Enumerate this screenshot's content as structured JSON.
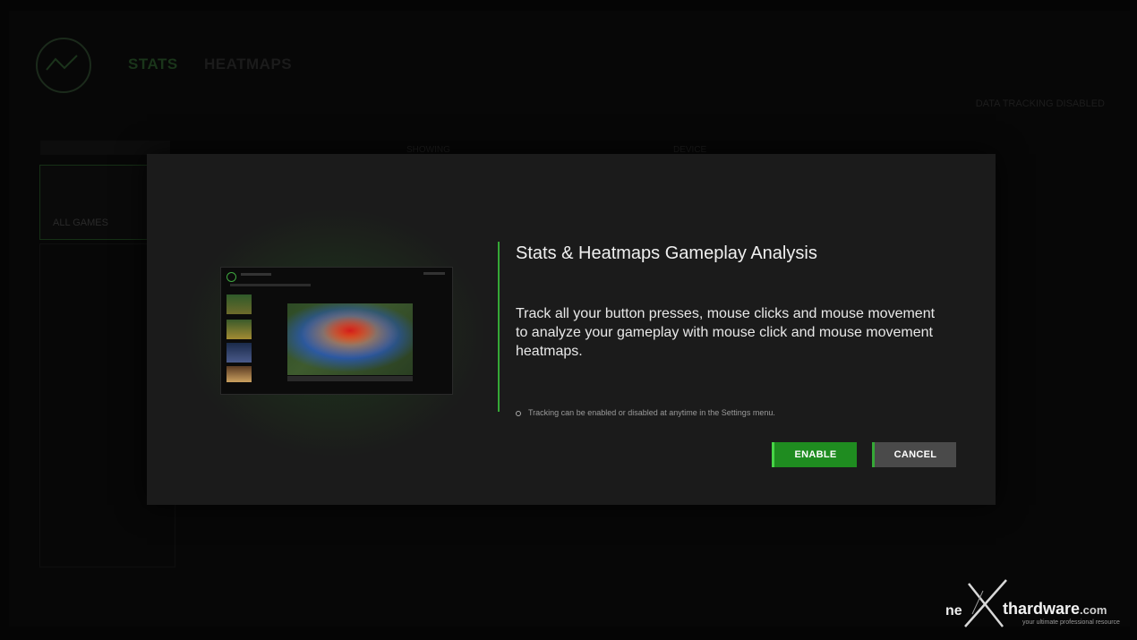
{
  "nav": {
    "stats": "STATS",
    "heatmaps": "HEATMAPS"
  },
  "status": {
    "tracking": "DATA TRACKING DISABLED"
  },
  "filters": {
    "showing_label": "SHOWING",
    "device_label": "DEVICE"
  },
  "sidebar": {
    "all_games_label": "ALL GAMES"
  },
  "dialog": {
    "title": "Stats & Heatmaps Gameplay Analysis",
    "description": "Track all your button presses, mouse clicks and mouse movement to analyze your gameplay with mouse click and mouse movement heatmaps.",
    "note": "Tracking can be enabled or disabled at anytime in the Settings menu.",
    "enable_label": "ENABLE",
    "cancel_label": "CANCEL"
  },
  "watermark": {
    "ne": "ne",
    "main": "thardware",
    "tld": ".com",
    "tagline": "your ultimate professional resource"
  },
  "colors": {
    "accent": "#35a836",
    "enable": "#1f8c20",
    "cancel": "#4a4a4a",
    "modal_bg": "#1b1b1b"
  }
}
